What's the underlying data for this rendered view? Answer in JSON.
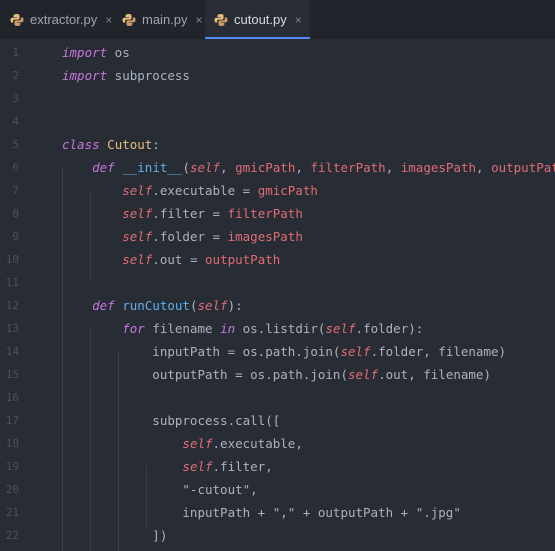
{
  "tabs": [
    {
      "label": "extractor.py",
      "close": "×",
      "active": false
    },
    {
      "label": "main.py",
      "close": "×",
      "active": false
    },
    {
      "label": "cutout.py",
      "close": "×",
      "active": true
    }
  ],
  "colors": {
    "editor_bg": "#282c34",
    "tabbar_bg": "#21252b",
    "keyword": "#c678dd",
    "self": "#e06c75",
    "class_name": "#e5c07b",
    "function": "#61afef",
    "parameter": "#e06c75",
    "string": "#98c379",
    "text": "#abb2bf",
    "line_number": "#495162",
    "active_tab_underline": "#528bff"
  },
  "icons": {
    "tab_file": "python-file-icon",
    "tab_close": "close-icon"
  },
  "lines": [
    {
      "n": "1",
      "tokens": [
        [
          "kw",
          "import"
        ],
        [
          "plain",
          " os"
        ]
      ]
    },
    {
      "n": "2",
      "tokens": [
        [
          "kw",
          "import"
        ],
        [
          "plain",
          " subprocess"
        ]
      ]
    },
    {
      "n": "3",
      "tokens": []
    },
    {
      "n": "4",
      "tokens": []
    },
    {
      "n": "5",
      "tokens": [
        [
          "kw",
          "class"
        ],
        [
          "plain",
          " "
        ],
        [
          "cls",
          "Cutout"
        ],
        [
          "plain",
          ":"
        ]
      ]
    },
    {
      "n": "6",
      "tokens": [
        [
          "plain",
          "    "
        ],
        [
          "kw",
          "def"
        ],
        [
          "plain",
          " "
        ],
        [
          "fn",
          "__init__"
        ],
        [
          "plain",
          "("
        ],
        [
          "sf",
          "self"
        ],
        [
          "plain",
          ", "
        ],
        [
          "par",
          "gmicPath"
        ],
        [
          "plain",
          ", "
        ],
        [
          "par",
          "filterPath"
        ],
        [
          "plain",
          ", "
        ],
        [
          "par",
          "imagesPath"
        ],
        [
          "plain",
          ", "
        ],
        [
          "par",
          "outputPath"
        ],
        [
          "plain",
          "):"
        ]
      ]
    },
    {
      "n": "7",
      "tokens": [
        [
          "plain",
          "        "
        ],
        [
          "sf",
          "self"
        ],
        [
          "plain",
          ".executable = "
        ],
        [
          "par",
          "gmicPath"
        ]
      ]
    },
    {
      "n": "8",
      "tokens": [
        [
          "plain",
          "        "
        ],
        [
          "sf",
          "self"
        ],
        [
          "plain",
          ".filter = "
        ],
        [
          "par",
          "filterPath"
        ]
      ]
    },
    {
      "n": "9",
      "tokens": [
        [
          "plain",
          "        "
        ],
        [
          "sf",
          "self"
        ],
        [
          "plain",
          ".folder = "
        ],
        [
          "par",
          "imagesPath"
        ]
      ]
    },
    {
      "n": "10",
      "tokens": [
        [
          "plain",
          "        "
        ],
        [
          "sf",
          "self"
        ],
        [
          "plain",
          ".out = "
        ],
        [
          "par",
          "outputPath"
        ]
      ]
    },
    {
      "n": "11",
      "tokens": []
    },
    {
      "n": "12",
      "tokens": [
        [
          "plain",
          "    "
        ],
        [
          "kw",
          "def"
        ],
        [
          "plain",
          " "
        ],
        [
          "fn",
          "runCutout"
        ],
        [
          "plain",
          "("
        ],
        [
          "sf",
          "self"
        ],
        [
          "plain",
          "):"
        ]
      ]
    },
    {
      "n": "13",
      "tokens": [
        [
          "plain",
          "        "
        ],
        [
          "kw",
          "for"
        ],
        [
          "plain",
          " filename "
        ],
        [
          "kw",
          "in"
        ],
        [
          "plain",
          " os.listdir("
        ],
        [
          "sf",
          "self"
        ],
        [
          "plain",
          ".folder):"
        ]
      ]
    },
    {
      "n": "14",
      "tokens": [
        [
          "plain",
          "            inputPath = os.path.join("
        ],
        [
          "sf",
          "self"
        ],
        [
          "plain",
          ".folder, filename)"
        ]
      ]
    },
    {
      "n": "15",
      "tokens": [
        [
          "plain",
          "            outputPath = os.path.join("
        ],
        [
          "sf",
          "self"
        ],
        [
          "plain",
          ".out, filename)"
        ]
      ]
    },
    {
      "n": "16",
      "tokens": []
    },
    {
      "n": "17",
      "tokens": [
        [
          "plain",
          "            subprocess.call(["
        ]
      ]
    },
    {
      "n": "18",
      "tokens": [
        [
          "plain",
          "                "
        ],
        [
          "sf",
          "self"
        ],
        [
          "plain",
          ".executable,"
        ]
      ]
    },
    {
      "n": "19",
      "tokens": [
        [
          "plain",
          "                "
        ],
        [
          "sf",
          "self"
        ],
        [
          "plain",
          ".filter,"
        ]
      ]
    },
    {
      "n": "20",
      "tokens": [
        [
          "plain",
          "                \"-cutout\","
        ]
      ]
    },
    {
      "n": "21",
      "tokens": [
        [
          "plain",
          "                inputPath + \",\" + outputPath + \".jpg\""
        ]
      ]
    },
    {
      "n": "22",
      "tokens": [
        [
          "plain",
          "            ])"
        ]
      ]
    }
  ]
}
